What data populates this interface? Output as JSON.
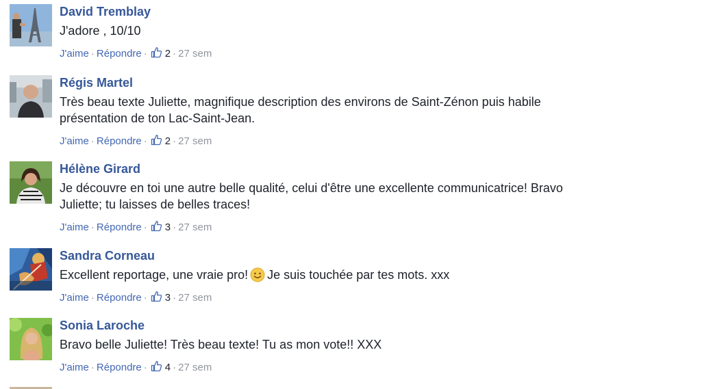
{
  "actions": {
    "like_label": "J'aime",
    "reply_label": "Répondre",
    "separator": "·"
  },
  "colors": {
    "name_link": "#365899",
    "action_link": "#4267b2",
    "meta_gray": "#90949c",
    "body_text": "#1d2129"
  },
  "comments": [
    {
      "author": "David Tremblay",
      "text": "J'adore , 10/10",
      "likes": "2",
      "time": "27 sem"
    },
    {
      "author": "Régis Martel",
      "text": "Très beau texte Juliette, magnifique description des environs de Saint-Zénon puis habile présentation de ton Lac-Saint-Jean.",
      "likes": "2",
      "time": "27 sem"
    },
    {
      "author": "Hélène Girard",
      "text": "Je découvre en toi une autre belle qualité, celui d'être une excellente communicatrice! Bravo Juliette; tu laisses de belles traces!",
      "likes": "3",
      "time": "27 sem"
    },
    {
      "author": "Sandra Corneau",
      "text_before": "Excellent reportage, une vraie pro!",
      "emoji": "smiley-emoji",
      "text_after": "Je suis touchée par tes mots. xxx",
      "likes": "3",
      "time": "27 sem"
    },
    {
      "author": "Sonia Laroche",
      "text": "Bravo belle Juliette! Très beau texte! Tu as mon vote!! XXX",
      "likes": "4",
      "time": "27 sem"
    }
  ]
}
